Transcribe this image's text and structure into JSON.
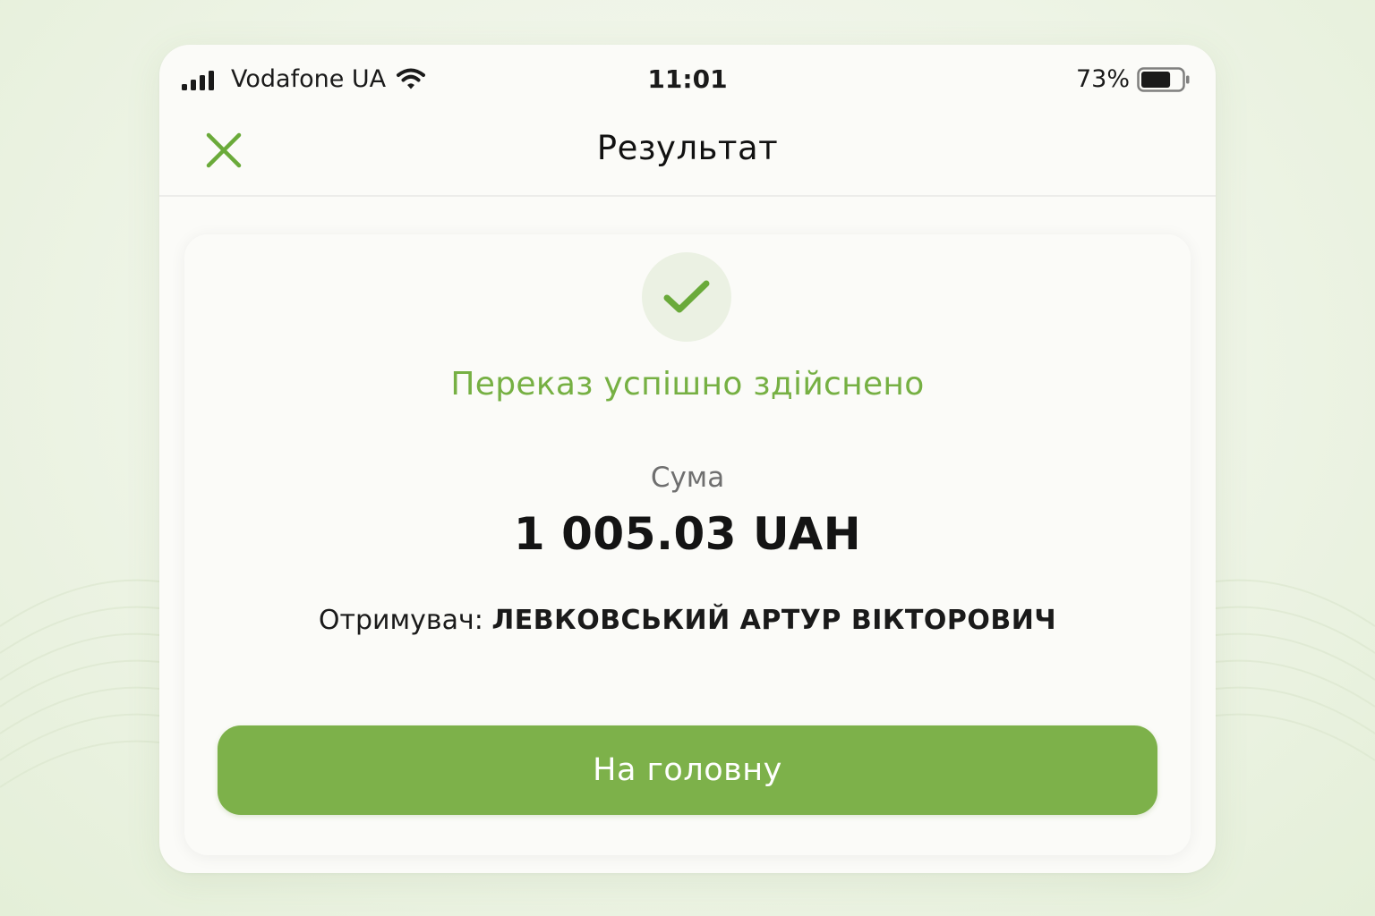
{
  "status_bar": {
    "carrier": "Vodafone UA",
    "time": "11:01",
    "battery_percent": "73%",
    "battery_level": 0.73,
    "icons": [
      "signal-icon",
      "wifi-icon",
      "battery-icon"
    ]
  },
  "nav": {
    "title": "Результат",
    "close_icon": "close-icon"
  },
  "result": {
    "status_icon": "checkmark-icon",
    "status_text": "Переказ успішно здійснено",
    "amount_label": "Сума",
    "amount_value": "1 005.03 UAH",
    "recipient_label": "Отримувач:",
    "recipient_name": "ЛЕВКОВСЬКИЙ АРТУР ВІКТОРОВИЧ"
  },
  "actions": {
    "home_label": "На головну"
  },
  "colors": {
    "accent_green": "#7db14a",
    "success_text_green": "#76b043",
    "success_circle_bg": "#ebf1e3",
    "page_bg": "#eef4e6",
    "card_bg": "#fbfbf8"
  }
}
